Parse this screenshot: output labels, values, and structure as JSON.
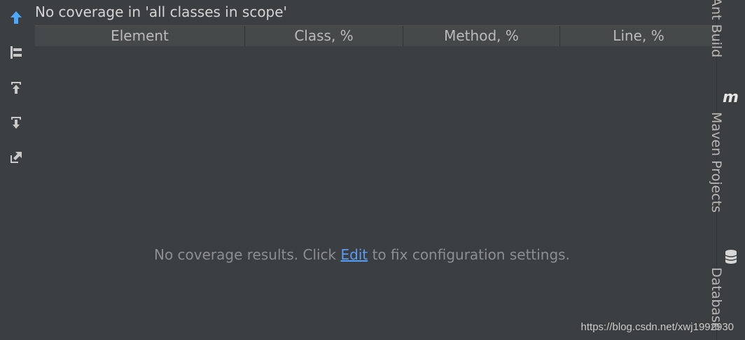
{
  "panel": {
    "title": "No coverage in 'all classes in scope'"
  },
  "table": {
    "columns": [
      "Element",
      "Class, %",
      "Method, %",
      "Line, %"
    ]
  },
  "empty_state": {
    "prefix": "No coverage results. Click ",
    "link": "Edit",
    "suffix": " to fix configuration settings."
  },
  "right_tool_windows": [
    {
      "label": "Ant Build"
    },
    {
      "label": "Maven Projects",
      "icon_text": "m"
    },
    {
      "label": "Database"
    }
  ],
  "left_toolbar": {
    "icons": [
      "up-arrow-icon",
      "flatten-packages-icon",
      "import-coverage-icon",
      "export-coverage-icon",
      "open-in-editor-icon"
    ]
  },
  "watermark": "https://blog.csdn.net/xwj1992930",
  "colors": {
    "background": "#3c3f41",
    "header": "#45494a",
    "text": "#bbbbbb",
    "link": "#589df6",
    "accent_arrow": "#4aa8ff"
  }
}
